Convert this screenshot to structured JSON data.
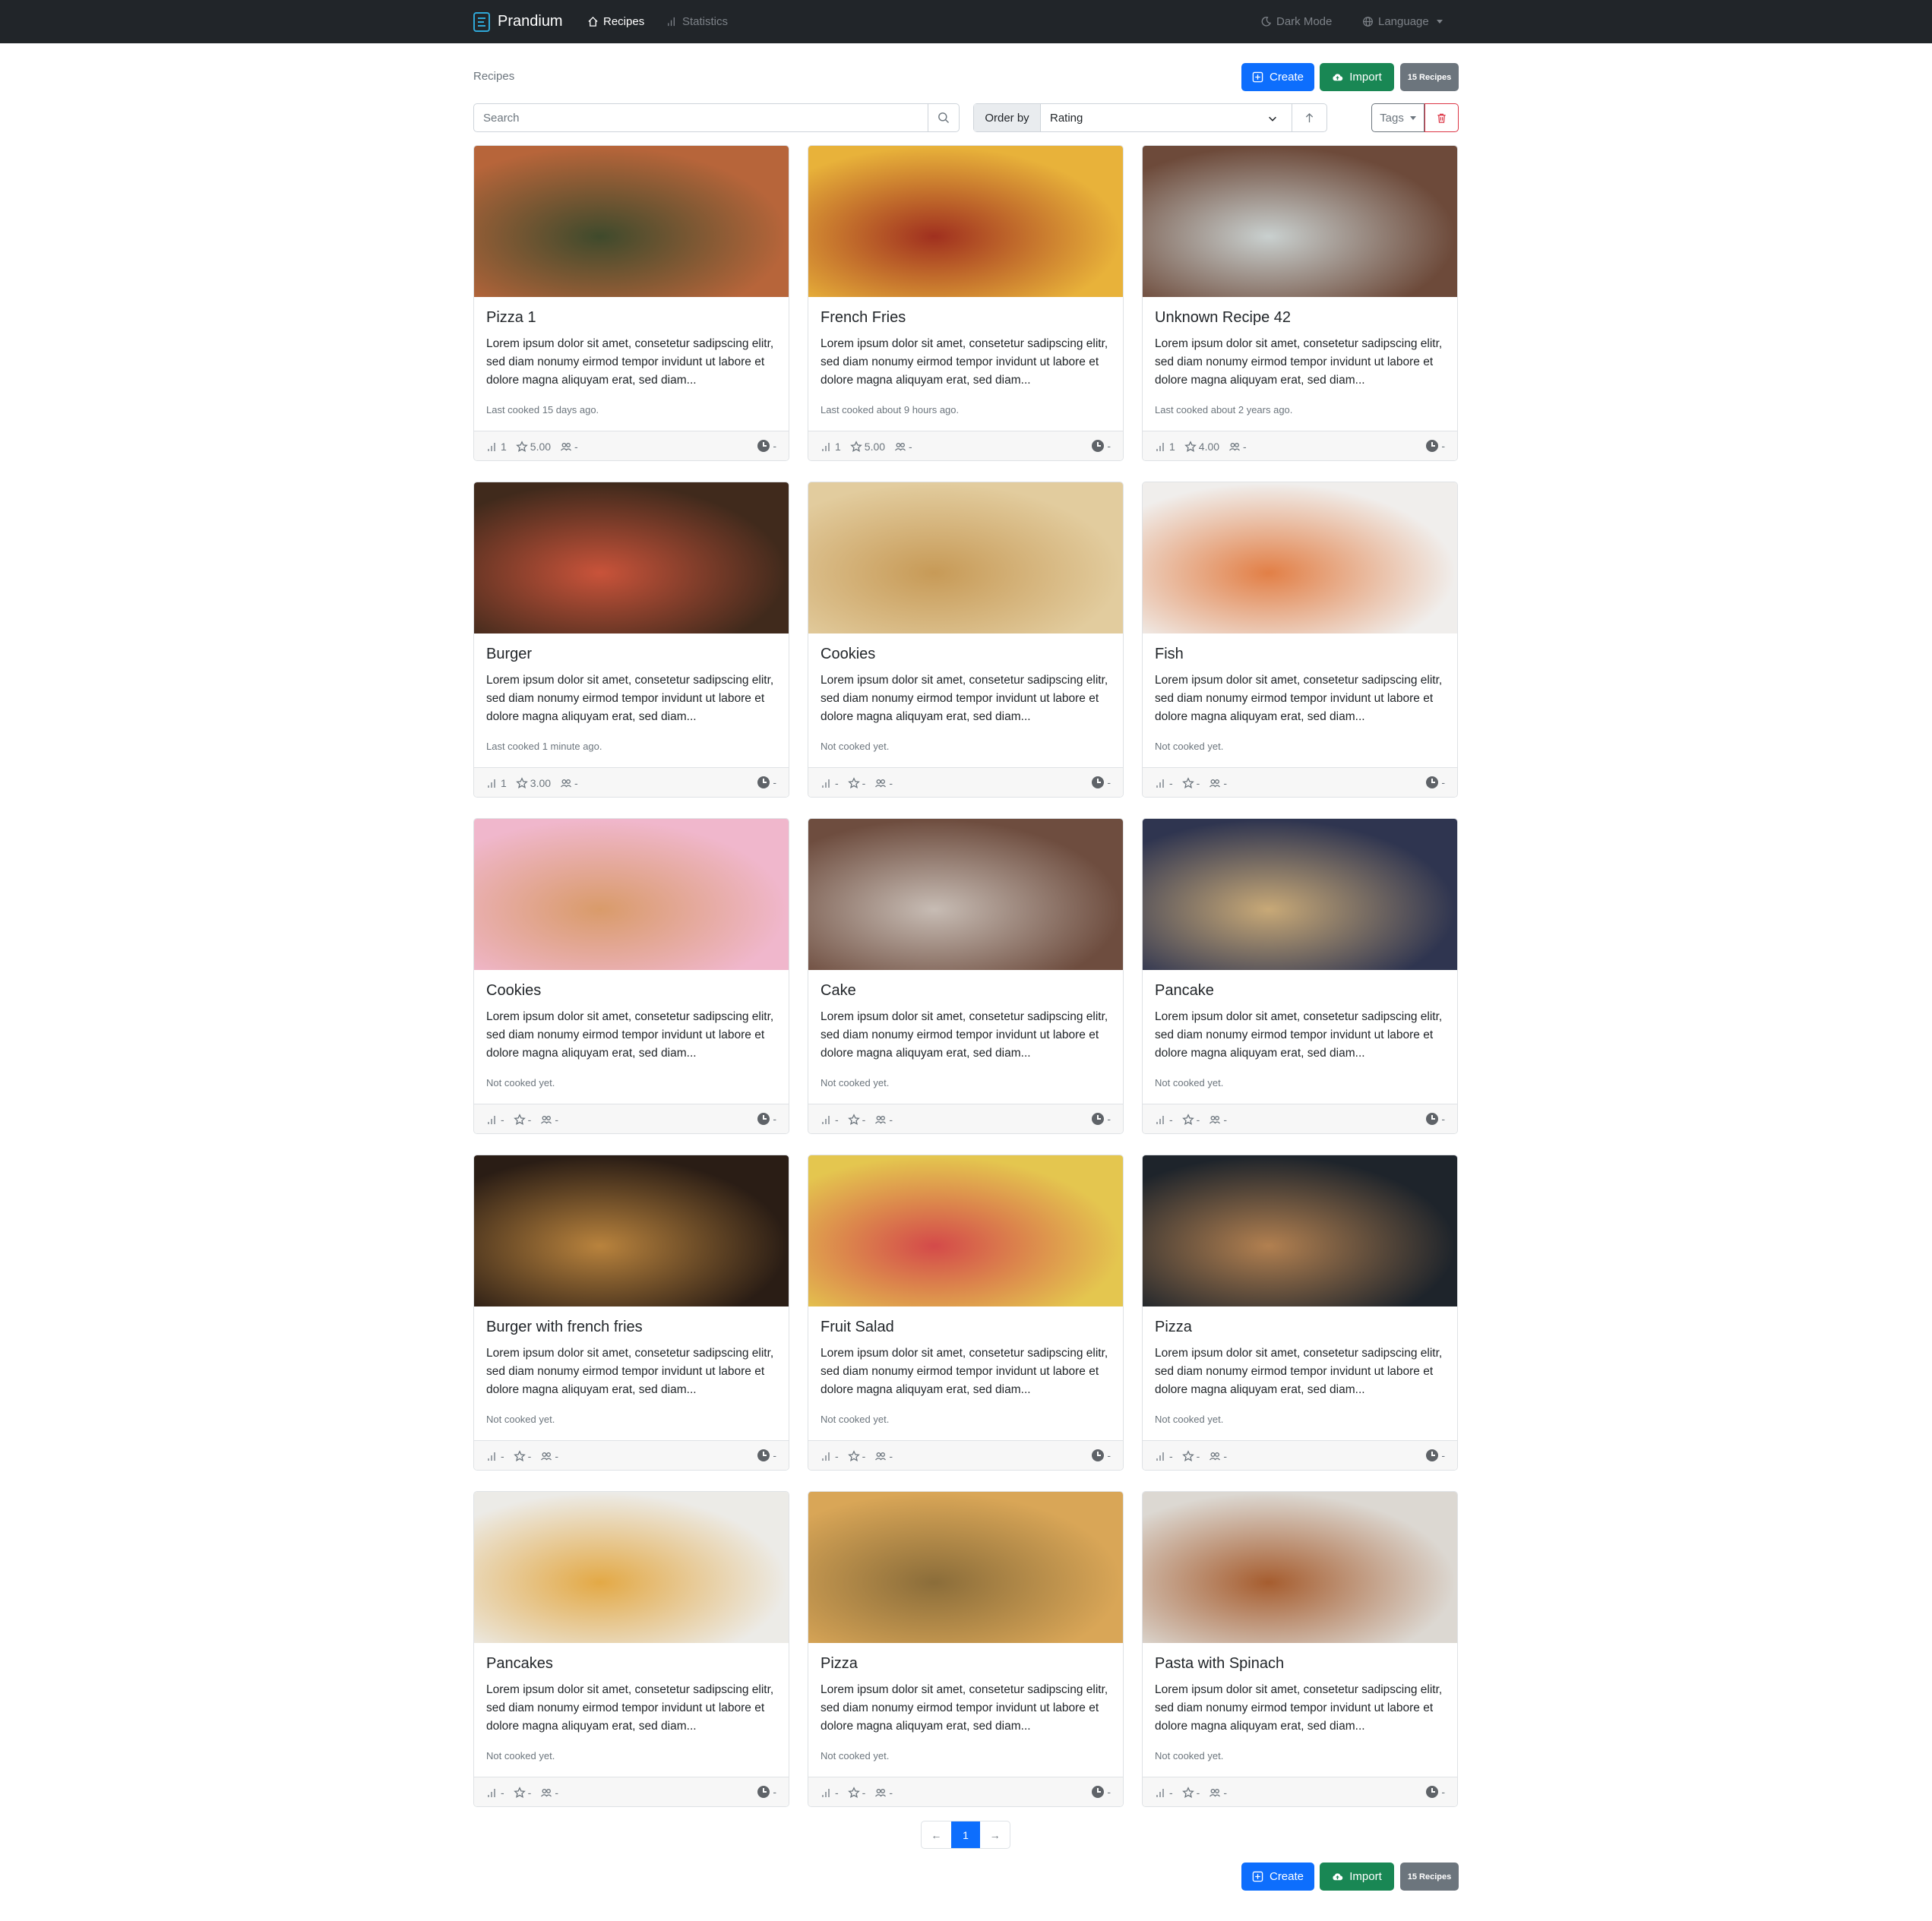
{
  "navbar": {
    "brand": "Prandium",
    "recipes": "Recipes",
    "statistics": "Statistics",
    "dark_mode": "Dark Mode",
    "language": "Language"
  },
  "header": {
    "title": "Recipes",
    "create": "Create",
    "import": "Import",
    "count_badge": "15 Recipes"
  },
  "filters": {
    "search_placeholder": "Search",
    "order_label": "Order by",
    "order_value": "Rating",
    "tags_label": "Tags"
  },
  "recipes": [
    {
      "title": "Pizza 1",
      "cooked": "Last cooked 15 days ago.",
      "count": "1",
      "rating": "5.00",
      "servings": "-",
      "time": "-"
    },
    {
      "title": "French Fries",
      "cooked": "Last cooked about 9 hours ago.",
      "count": "1",
      "rating": "5.00",
      "servings": "-",
      "time": "-"
    },
    {
      "title": "Unknown Recipe 42",
      "cooked": "Last cooked about 2 years ago.",
      "count": "1",
      "rating": "4.00",
      "servings": "-",
      "time": "-"
    },
    {
      "title": "Burger",
      "cooked": "Last cooked 1 minute ago.",
      "count": "1",
      "rating": "3.00",
      "servings": "-",
      "time": "-"
    },
    {
      "title": "Cookies",
      "cooked": "Not cooked yet.",
      "count": "-",
      "rating": "-",
      "servings": "-",
      "time": "-"
    },
    {
      "title": "Fish",
      "cooked": "Not cooked yet.",
      "count": "-",
      "rating": "-",
      "servings": "-",
      "time": "-"
    },
    {
      "title": "Cookies",
      "cooked": "Not cooked yet.",
      "count": "-",
      "rating": "-",
      "servings": "-",
      "time": "-"
    },
    {
      "title": "Cake",
      "cooked": "Not cooked yet.",
      "count": "-",
      "rating": "-",
      "servings": "-",
      "time": "-"
    },
    {
      "title": "Pancake",
      "cooked": "Not cooked yet.",
      "count": "-",
      "rating": "-",
      "servings": "-",
      "time": "-"
    },
    {
      "title": "Burger with french fries",
      "cooked": "Not cooked yet.",
      "count": "-",
      "rating": "-",
      "servings": "-",
      "time": "-"
    },
    {
      "title": "Fruit Salad",
      "cooked": "Not cooked yet.",
      "count": "-",
      "rating": "-",
      "servings": "-",
      "time": "-"
    },
    {
      "title": "Pizza",
      "cooked": "Not cooked yet.",
      "count": "-",
      "rating": "-",
      "servings": "-",
      "time": "-"
    },
    {
      "title": "Pancakes",
      "cooked": "Not cooked yet.",
      "count": "-",
      "rating": "-",
      "servings": "-",
      "time": "-"
    },
    {
      "title": "Pizza",
      "cooked": "Not cooked yet.",
      "count": "-",
      "rating": "-",
      "servings": "-",
      "time": "-"
    },
    {
      "title": "Pasta with Spinach",
      "cooked": "Not cooked yet.",
      "count": "-",
      "rating": "-",
      "servings": "-",
      "time": "-"
    }
  ],
  "description": "Lorem ipsum dolor sit amet, consetetur sadipscing elitr, sed diam nonumy eirmod tempor invidunt ut labore et dolore magna aliquyam erat, sed diam...",
  "pagination": {
    "prev": "←",
    "current": "1",
    "next": "→"
  },
  "image_colors": [
    [
      "#b7653a",
      "#3f4a2c"
    ],
    [
      "#e8b23a",
      "#a0301f"
    ],
    [
      "#6d4a3a",
      "#c9d0cf"
    ],
    [
      "#402a1c",
      "#c9533a"
    ],
    [
      "#e2cc9e",
      "#c79a57"
    ],
    [
      "#f0eeec",
      "#e27f46"
    ],
    [
      "#f0b7cc",
      "#d99b6a"
    ],
    [
      "#6e4d3f",
      "#c7bcb4"
    ],
    [
      "#2f3550",
      "#c8a977"
    ],
    [
      "#2a1d15",
      "#b9833d"
    ],
    [
      "#e4c64f",
      "#d44a4a"
    ],
    [
      "#1e242b",
      "#b28050"
    ],
    [
      "#ecebe7",
      "#e3a946"
    ],
    [
      "#d9a657",
      "#8b6d3a"
    ],
    [
      "#dcd8d2",
      "#a65d2f"
    ]
  ],
  "colors": {
    "primary": "#0d6efd",
    "success": "#198754",
    "secondary": "#6c757d",
    "danger": "#dc3545",
    "navbar": "#212529"
  }
}
